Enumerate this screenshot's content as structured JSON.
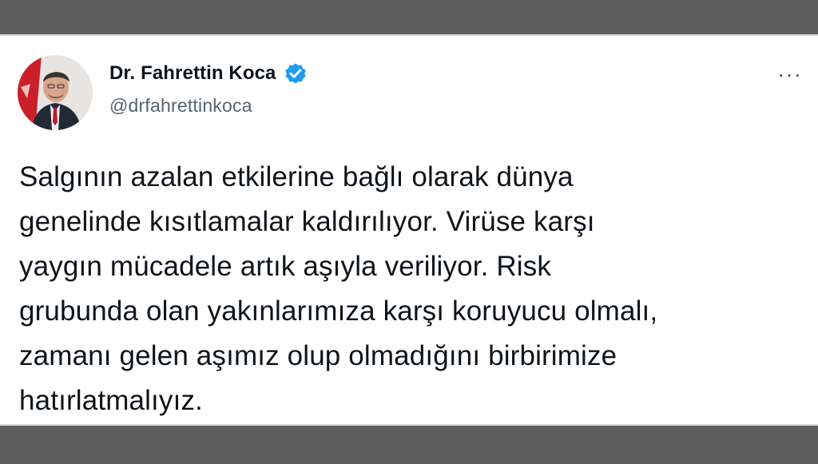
{
  "tweet": {
    "author": {
      "display_name": "Dr. Fahrettin Koca",
      "handle": "@drfahrettinkoca",
      "verified": true,
      "avatar_icon": "profile-photo"
    },
    "more_icon": "more-dots-icon",
    "more_label": "···",
    "text": "Salgının azalan etkilerine bağlı olarak dünya\ngenelinde kısıtlamalar kaldırılıyor. Virüse karşı\nyaygın mücadele artık aşıyla veriliyor. Risk\ngrubunda olan yakınlarımıza karşı koruyucu olmalı,\nzamanı gelen aşımız olup olmadığını birbirimize\nhatırlatmalıyız."
  },
  "colors": {
    "background": "#5e5e5e",
    "card": "#ffffff",
    "text_primary": "#0f1419",
    "text_secondary": "#536471",
    "verified_blue": "#1d9bf0"
  }
}
